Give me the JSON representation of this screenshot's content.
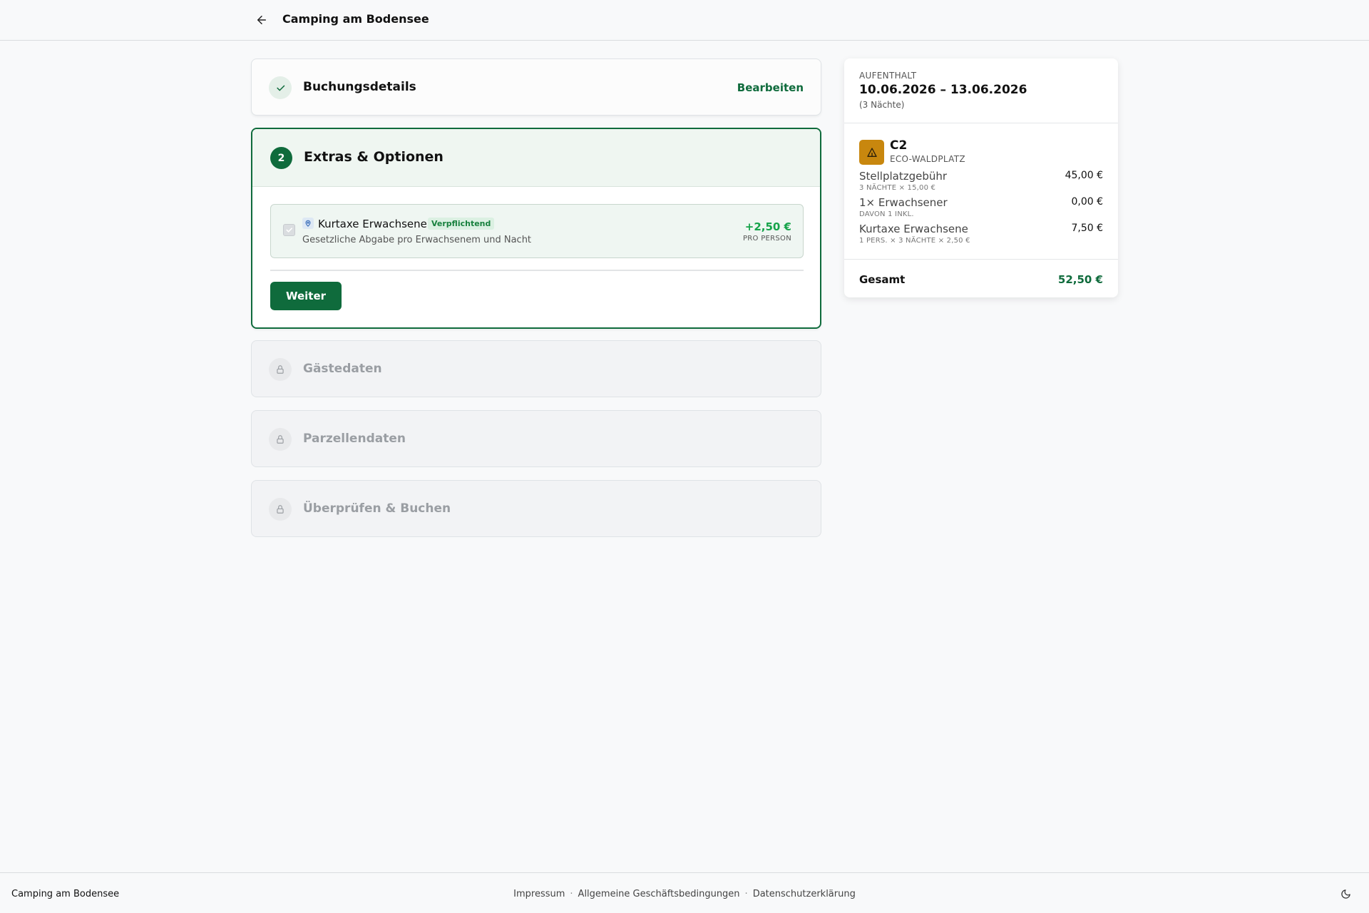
{
  "header": {
    "title": "Camping am Bodensee",
    "back_icon": "arrow-left-icon"
  },
  "steps": {
    "done": {
      "title": "Buchungsdetails",
      "edit_label": "Bearbeiten",
      "icon": "check-icon"
    },
    "active": {
      "number": "2",
      "title": "Extras & Optionen",
      "extra": {
        "name": "Kurtaxe Erwachsene",
        "badge": "Verpflichtend",
        "description": "Gesetzliche Abgabe pro Erwachsenem und Nacht",
        "price": "+2,50 €",
        "unit": "PRO PERSON",
        "checked": true
      },
      "next_label": "Weiter"
    },
    "locked": [
      {
        "title": "Gästedaten",
        "icon": "lock-icon"
      },
      {
        "title": "Parzellendaten",
        "icon": "lock-icon"
      },
      {
        "title": "Überprüfen & Buchen",
        "icon": "lock-icon"
      }
    ]
  },
  "summary": {
    "label": "AUFENTHALT",
    "dates": "10.06.2026 – 13.06.2026",
    "nights": "(3 Nächte)",
    "pitch": {
      "name": "C2",
      "type": "ECO-WALDPLATZ",
      "icon": "tent-icon",
      "icon_color": "#c8870e"
    },
    "lines": [
      {
        "name": "Stellplatzgebühr",
        "sub": "3 NÄCHTE × 15,00 €",
        "value": "45,00 €"
      },
      {
        "name": "1× Erwachsener",
        "sub": "DAVON 1 INKL.",
        "value": "0,00 €"
      },
      {
        "name": "Kurtaxe Erwachsene",
        "sub": "1 PERS. × 3 NÄCHTE × 2,50 €",
        "value": "7,50 €"
      }
    ],
    "total_label": "Gesamt",
    "total_value": "52,50 €"
  },
  "footer": {
    "brand": "Camping am Bodensee",
    "links": [
      "Impressum",
      "Allgemeine Geschäftsbedingungen",
      "Datenschutzerklärung"
    ],
    "theme_icon": "moon-icon"
  },
  "colors": {
    "accent": "#0f6b3c",
    "price": "#16a34a",
    "badge_bg": "#dbf0e2"
  }
}
